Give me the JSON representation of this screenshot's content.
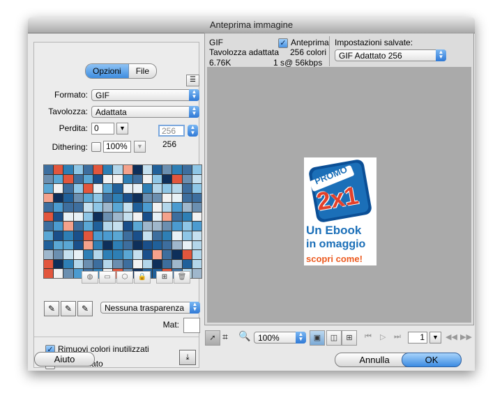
{
  "window": {
    "title": "Anteprima immagine"
  },
  "left": {
    "tabs": [
      "Opzioni",
      "File"
    ],
    "active_tab": "Opzioni",
    "menu_icon": "list-menu-icon",
    "format_label": "Formato:",
    "format_value": "GIF",
    "palette_label": "Tavolozza:",
    "palette_value": "Adattata",
    "loss_label": "Perdita:",
    "loss_value": "0",
    "colors_value": "256",
    "colors_count": "256",
    "dither_label": "Dithering:",
    "dither_value": "100%",
    "transparency_value": "Nessuna trasparenza",
    "mat_label": "Mat:",
    "remove_unused_label": "Rimuovi colori inutilizzati",
    "remove_unused_checked": true,
    "interlaced_label": "Interlacciato",
    "interlaced_checked": false,
    "help_button": "Aiuto",
    "palette_colors": [
      "#1a4f8a",
      "#2e7fb5",
      "#5aa7d4",
      "#8ec6e6",
      "#c5e0ef",
      "#e8f1f6",
      "#0e2f5a",
      "#3d6e9e",
      "#e2563d",
      "#f4a28c",
      "#6b8fb0",
      "#9fb7cc",
      "#20609a",
      "#4b9bd0",
      "#b3d6ea",
      "#f2f2f2"
    ]
  },
  "preview": {
    "format": "GIF",
    "palette": "Tavolozza adattata",
    "size": "6.76K",
    "preview_label": "Anteprima",
    "preview_checked": true,
    "colors": "256 colori",
    "speed": "1 s@ 56kbps",
    "saved_label": "Impostazioni salvate:",
    "saved_value": "GIF Adattato 256",
    "ad": {
      "promo": "PROMO",
      "big": "2x1",
      "line1": "Un Ebook",
      "line2": "in omaggio",
      "line3": "scopri come!"
    }
  },
  "toolbar": {
    "zoom": "100%",
    "frame": "1"
  },
  "buttons": {
    "cancel": "Annulla",
    "ok": "OK"
  },
  "colors": {
    "accent": "#3c8be2",
    "promo_blue": "#1b6fb8",
    "promo_red": "#e3412b",
    "ad_orange": "#ec5a1f"
  }
}
